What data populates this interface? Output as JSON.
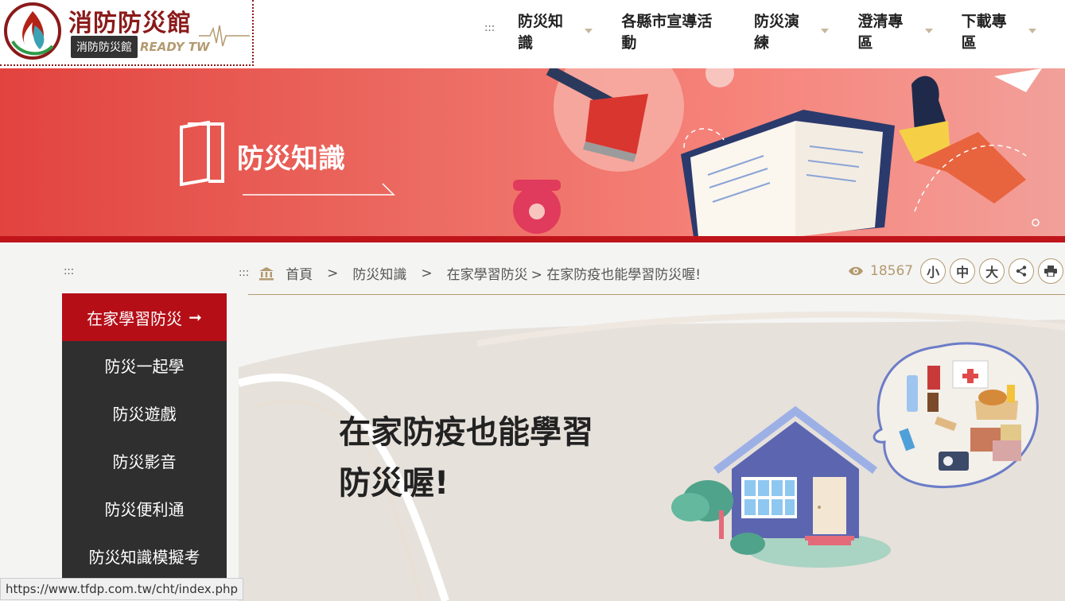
{
  "header": {
    "logo_title": "消防防災館",
    "logo_subtitle": "READY TW",
    "tooltip": "消防防災館",
    "nav_dots": ":::",
    "nav": [
      {
        "label": "防災知識",
        "has_dropdown": true
      },
      {
        "label": "各縣市宣導活動",
        "has_dropdown": false
      },
      {
        "label": "防災演練",
        "has_dropdown": true
      },
      {
        "label": "澄清專區",
        "has_dropdown": true
      },
      {
        "label": "下載專區",
        "has_dropdown": true
      }
    ]
  },
  "banner": {
    "title": "防災知識"
  },
  "breadcrumb": {
    "dots": ":::",
    "items": [
      "首頁",
      ">",
      "防災知識",
      ">",
      "在家學習防災",
      "> 在家防疫也能學習防災喔!"
    ]
  },
  "tools": {
    "view_count": "18567",
    "buttons": [
      "小",
      "中",
      "大"
    ]
  },
  "sidebar": {
    "dots": ":::",
    "items": [
      {
        "label": "在家學習防災",
        "active": true,
        "arrow": "➞"
      },
      {
        "label": "防災一起學",
        "active": false
      },
      {
        "label": "防災遊戲",
        "active": false
      },
      {
        "label": "防災影音",
        "active": false
      },
      {
        "label": "防災便利通",
        "active": false
      },
      {
        "label": "防災知識模擬考",
        "active": false
      }
    ]
  },
  "content": {
    "title_line1": "在家防疫也能學習",
    "title_line2": "防災喔!"
  },
  "status_bar": {
    "url": "https://www.tfdp.com.tw/cht/index.php"
  },
  "colors": {
    "brand_red": "#b50e17",
    "banner_red": "#e2433f",
    "accent_gold": "#b49a70",
    "sidebar_dark": "#2f2f2f"
  }
}
